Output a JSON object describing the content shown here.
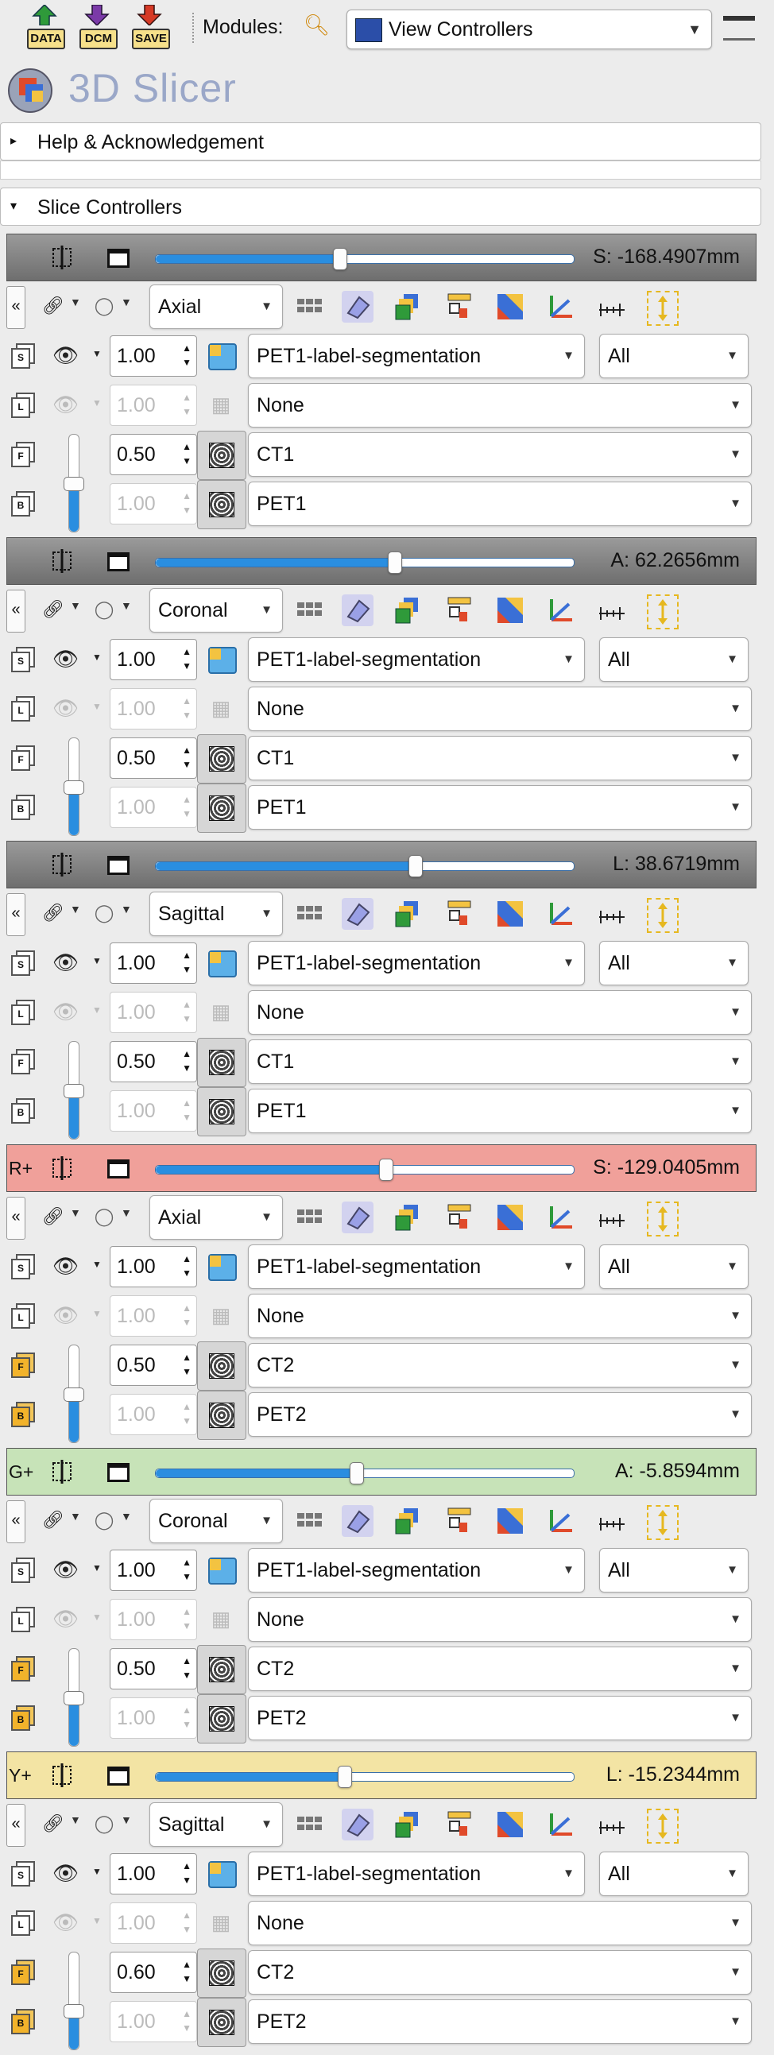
{
  "toolbar": {
    "data_label": "DATA",
    "dcm_label": "DCM",
    "save_label": "SAVE",
    "modules_label": "Modules:",
    "module_selected": "View Controllers"
  },
  "app": {
    "title": "3D Slicer"
  },
  "panels": {
    "help": "Help & Acknowledgement",
    "slice_controllers": "Slice Controllers"
  },
  "colors": {
    "slider_fill": "#2a8ee0",
    "gray_bar": "#7c7c7c",
    "red_bar": "#f0a09a",
    "green_bar": "#c7e3b8",
    "yellow_bar": "#f3e4a4"
  },
  "controllers": [
    {
      "prefix": "",
      "offset": "S: -168.4907mm",
      "slider_fraction": 0.44,
      "orientation": "Axial",
      "label_volume": "PET1-label-segmentation",
      "label_opacity": "1.00",
      "label_segments": "All",
      "fg_layer": "None",
      "fg_opacity": "1.00",
      "bg_opacity": "0.50",
      "bg_volume": "CT1",
      "vol2_opacity": "1.00",
      "vol2": "PET1"
    },
    {
      "prefix": "",
      "offset": "A: 62.2656mm",
      "slider_fraction": 0.57,
      "orientation": "Coronal",
      "label_volume": "PET1-label-segmentation",
      "label_opacity": "1.00",
      "label_segments": "All",
      "fg_layer": "None",
      "fg_opacity": "1.00",
      "bg_opacity": "0.50",
      "bg_volume": "CT1",
      "vol2_opacity": "1.00",
      "vol2": "PET1"
    },
    {
      "prefix": "",
      "offset": "L: 38.6719mm",
      "slider_fraction": 0.62,
      "orientation": "Sagittal",
      "label_volume": "PET1-label-segmentation",
      "label_opacity": "1.00",
      "label_segments": "All",
      "fg_layer": "None",
      "fg_opacity": "1.00",
      "bg_opacity": "0.50",
      "bg_volume": "CT1",
      "vol2_opacity": "1.00",
      "vol2": "PET1"
    },
    {
      "prefix": "R+",
      "offset": "S: -129.0405mm",
      "slider_fraction": 0.55,
      "orientation": "Axial",
      "label_volume": "PET1-label-segmentation",
      "label_opacity": "1.00",
      "label_segments": "All",
      "fg_layer": "None",
      "fg_opacity": "1.00",
      "bg_opacity": "0.50",
      "bg_volume": "CT2",
      "vol2_opacity": "1.00",
      "vol2": "PET2"
    },
    {
      "prefix": "G+",
      "offset": "A: -5.8594mm",
      "slider_fraction": 0.48,
      "orientation": "Coronal",
      "label_volume": "PET1-label-segmentation",
      "label_opacity": "1.00",
      "label_segments": "All",
      "fg_layer": "None",
      "fg_opacity": "1.00",
      "bg_opacity": "0.50",
      "bg_volume": "CT2",
      "vol2_opacity": "1.00",
      "vol2": "PET2"
    },
    {
      "prefix": "Y+",
      "offset": "L: -15.2344mm",
      "slider_fraction": 0.45,
      "orientation": "Sagittal",
      "label_volume": "PET1-label-segmentation",
      "label_opacity": "1.00",
      "label_segments": "All",
      "fg_layer": "None",
      "fg_opacity": "1.00",
      "bg_opacity": "0.60",
      "bg_volume": "CT2",
      "vol2_opacity": "1.00",
      "vol2": "PET2"
    }
  ]
}
